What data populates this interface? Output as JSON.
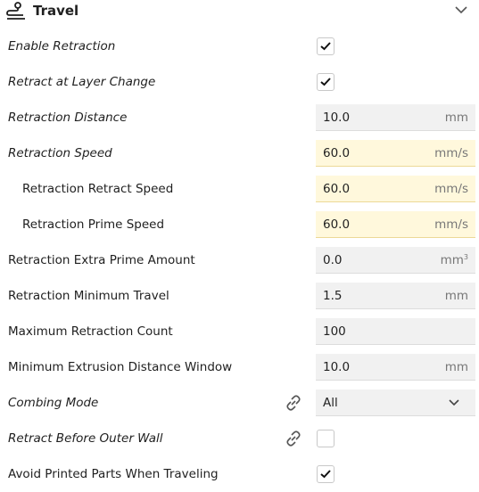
{
  "section": {
    "title": "Travel",
    "icon": "travel-icon",
    "collapse_icon": "chevron-down-icon"
  },
  "settings": [
    {
      "label": "Enable Retraction",
      "type": "checkbox",
      "checked": true,
      "italic": true
    },
    {
      "label": "Retract at Layer Change",
      "type": "checkbox",
      "checked": true,
      "italic": true
    },
    {
      "label": "Retraction Distance",
      "type": "number",
      "value": "10.0",
      "unit": "mm",
      "italic": true
    },
    {
      "label": "Retraction Speed",
      "type": "number",
      "value": "60.0",
      "unit": "mm/s",
      "italic": true,
      "highlighted": true
    },
    {
      "label": "Retraction Retract Speed",
      "type": "number",
      "value": "60.0",
      "unit": "mm/s",
      "indented": true,
      "highlighted": true
    },
    {
      "label": "Retraction Prime Speed",
      "type": "number",
      "value": "60.0",
      "unit": "mm/s",
      "indented": true,
      "highlighted": true
    },
    {
      "label": "Retraction Extra Prime Amount",
      "type": "number",
      "value": "0.0",
      "unit": "mm",
      "unit_sup": "3"
    },
    {
      "label": "Retraction Minimum Travel",
      "type": "number",
      "value": "1.5",
      "unit": "mm"
    },
    {
      "label": "Maximum Retraction Count",
      "type": "number",
      "value": "100",
      "unit": ""
    },
    {
      "label": "Minimum Extrusion Distance Window",
      "type": "number",
      "value": "10.0",
      "unit": "mm"
    },
    {
      "label": "Combing Mode",
      "type": "dropdown",
      "value": "All",
      "italic": true,
      "linked": true
    },
    {
      "label": "Retract Before Outer Wall",
      "type": "checkbox",
      "checked": false,
      "italic": true,
      "linked": true
    },
    {
      "label": "Avoid Printed Parts When Traveling",
      "type": "checkbox",
      "checked": true
    }
  ],
  "colors": {
    "field_bg": "#f1f1f1",
    "highlight_bg": "#fff8dc",
    "text": "#1f1f1f",
    "unit_text": "#777777"
  }
}
